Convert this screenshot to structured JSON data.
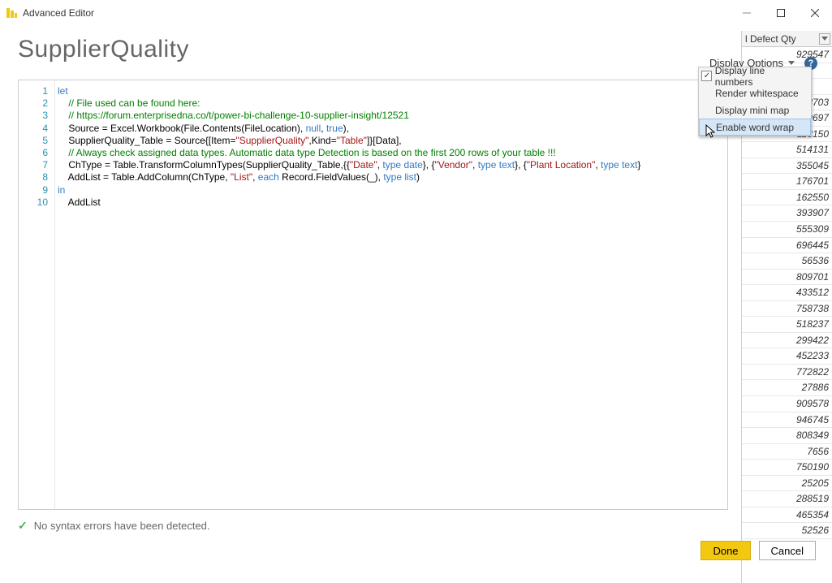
{
  "window": {
    "title": "Advanced Editor",
    "query_name": "SupplierQuality"
  },
  "display_options": {
    "label": "Display Options",
    "menu": {
      "line_numbers": "Display line numbers",
      "whitespace": "Render whitespace",
      "mini_map": "Display mini map",
      "word_wrap": "Enable word wrap"
    }
  },
  "code": {
    "lines": [
      "let",
      "    // File used can be found here:",
      "    // https://forum.enterprisedna.co/t/power-bi-challenge-10-supplier-insight/12521",
      "    Source = Excel.Workbook(File.Contents(FileLocation), null, true),",
      "    SupplierQuality_Table = Source{[Item=\"SupplierQuality\",Kind=\"Table\"]}[Data],",
      "    // Always check assigned data types. Automatic data type Detection is based on the first 200 rows of your table !!!",
      "    ChType = Table.TransformColumnTypes(SupplierQuality_Table,{{\"Date\", type date}, {\"Vendor\", type text}, {\"Plant Location\", type text}",
      "    AddList = Table.AddColumn(ChType, \"List\", each Record.FieldValues(_), type list)",
      "in",
      "    AddList"
    ]
  },
  "status": {
    "text": "No syntax errors have been detected."
  },
  "buttons": {
    "done": "Done",
    "cancel": "Cancel"
  },
  "bg_column": {
    "header": "l Defect Qty",
    "values": [
      "929547",
      "",
      "",
      "258703",
      "209697",
      "113150",
      "514131",
      "355045",
      "176701",
      "162550",
      "393907",
      "555309",
      "696445",
      "56536",
      "809701",
      "433512",
      "758738",
      "518237",
      "299422",
      "452233",
      "772822",
      "27886",
      "909578",
      "946745",
      "808349",
      "7656",
      "750190",
      "25205",
      "288519",
      "465354",
      "52526"
    ]
  }
}
